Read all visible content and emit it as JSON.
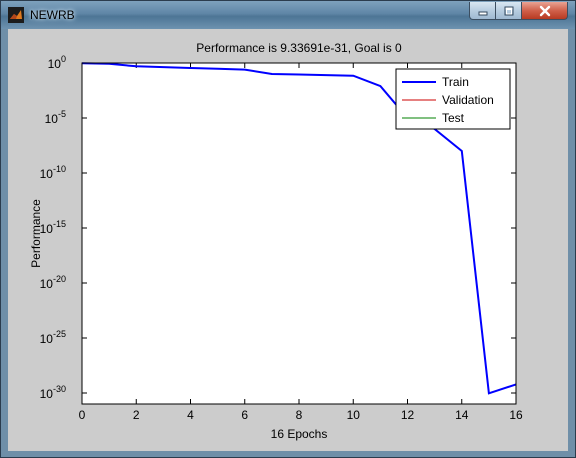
{
  "window": {
    "title": "NEWRB",
    "controls": {
      "minimize": "minimize",
      "maximize": "maximize",
      "close": "close"
    }
  },
  "chart_data": {
    "type": "line",
    "title": "Performance is 9.33691e-31, Goal is 0",
    "xlabel": "16 Epochs",
    "ylabel": "Performance",
    "xlim": [
      0,
      16
    ],
    "yscale": "log",
    "ylim": [
      1e-31,
      1
    ],
    "grid": false,
    "xticks": [
      "0",
      "2",
      "4",
      "6",
      "8",
      "10",
      "12",
      "14",
      "16"
    ],
    "yticks": [
      {
        "base": "10",
        "exp": "0"
      },
      {
        "base": "10",
        "exp": "-5"
      },
      {
        "base": "10",
        "exp": "-10"
      },
      {
        "base": "10",
        "exp": "-15"
      },
      {
        "base": "10",
        "exp": "-20"
      },
      {
        "base": "10",
        "exp": "-25"
      },
      {
        "base": "10",
        "exp": "-30"
      }
    ],
    "legend": {
      "position": "top-right"
    },
    "series": [
      {
        "name": "Train",
        "color": "#0000ff",
        "x": [
          0,
          1,
          2,
          3,
          4,
          5,
          6,
          7,
          8,
          9,
          10,
          11,
          12,
          13,
          14,
          15,
          16
        ],
        "y": [
          0.95,
          0.85,
          0.5,
          0.42,
          0.35,
          0.3,
          0.25,
          0.1,
          0.09,
          0.08,
          0.07,
          0.008,
          1e-05,
          1e-06,
          1e-08,
          9.33691e-31,
          6e-30
        ]
      },
      {
        "name": "Validation",
        "color": "#cc0000",
        "x": [],
        "y": []
      },
      {
        "name": "Test",
        "color": "#008000",
        "x": [],
        "y": []
      }
    ]
  }
}
